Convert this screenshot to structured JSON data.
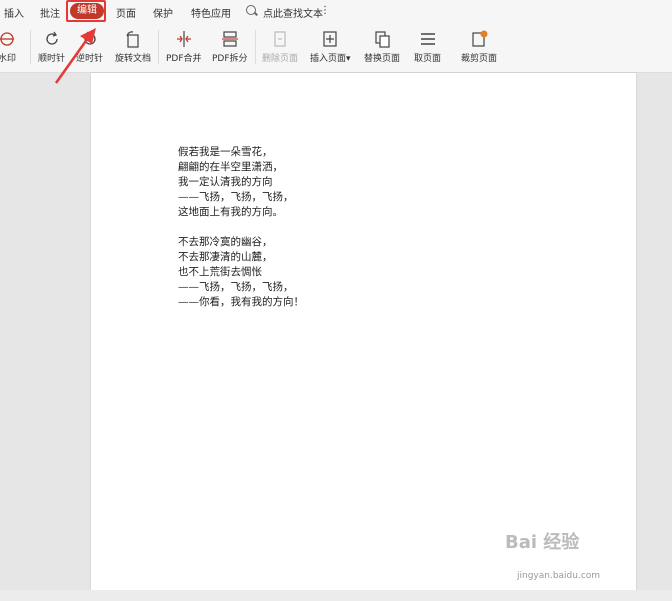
{
  "menu": {
    "items": [
      "插入",
      "批注",
      "编辑",
      "页面",
      "保护",
      "特色应用"
    ],
    "active_index": 2,
    "search_label": "点此查找文本"
  },
  "toolbar": {
    "watermark": "水印",
    "rotate_cw": "顺时针",
    "rotate_ccw": "逆时针",
    "rotate_doc": "旋转文档",
    "pdf_merge": "PDF合并",
    "pdf_split": "PDF拆分",
    "delete_page": "删除页面",
    "insert_page": "插入页面",
    "replace_page": "替换页面",
    "extract_page": "取页面",
    "crop_page": "裁剪页面"
  },
  "document": {
    "stanza1": [
      "假若我是一朵雪花，",
      "翩翩的在半空里潇洒，",
      "我一定认清我的方向",
      "——飞扬，飞扬，飞扬，",
      "这地面上有我的方向。"
    ],
    "stanza2": [
      "不去那冷寞的幽谷，",
      "不去那凄清的山麓，",
      "也不上荒街去惆怅",
      "——飞扬，飞扬，飞扬，",
      "——你看，我有我的方向！"
    ]
  },
  "watermark": {
    "brand": "Bai 经验",
    "url": "jingyan.baidu.com"
  },
  "colors": {
    "accent": "#c0392b",
    "highlight": "#e53935"
  }
}
